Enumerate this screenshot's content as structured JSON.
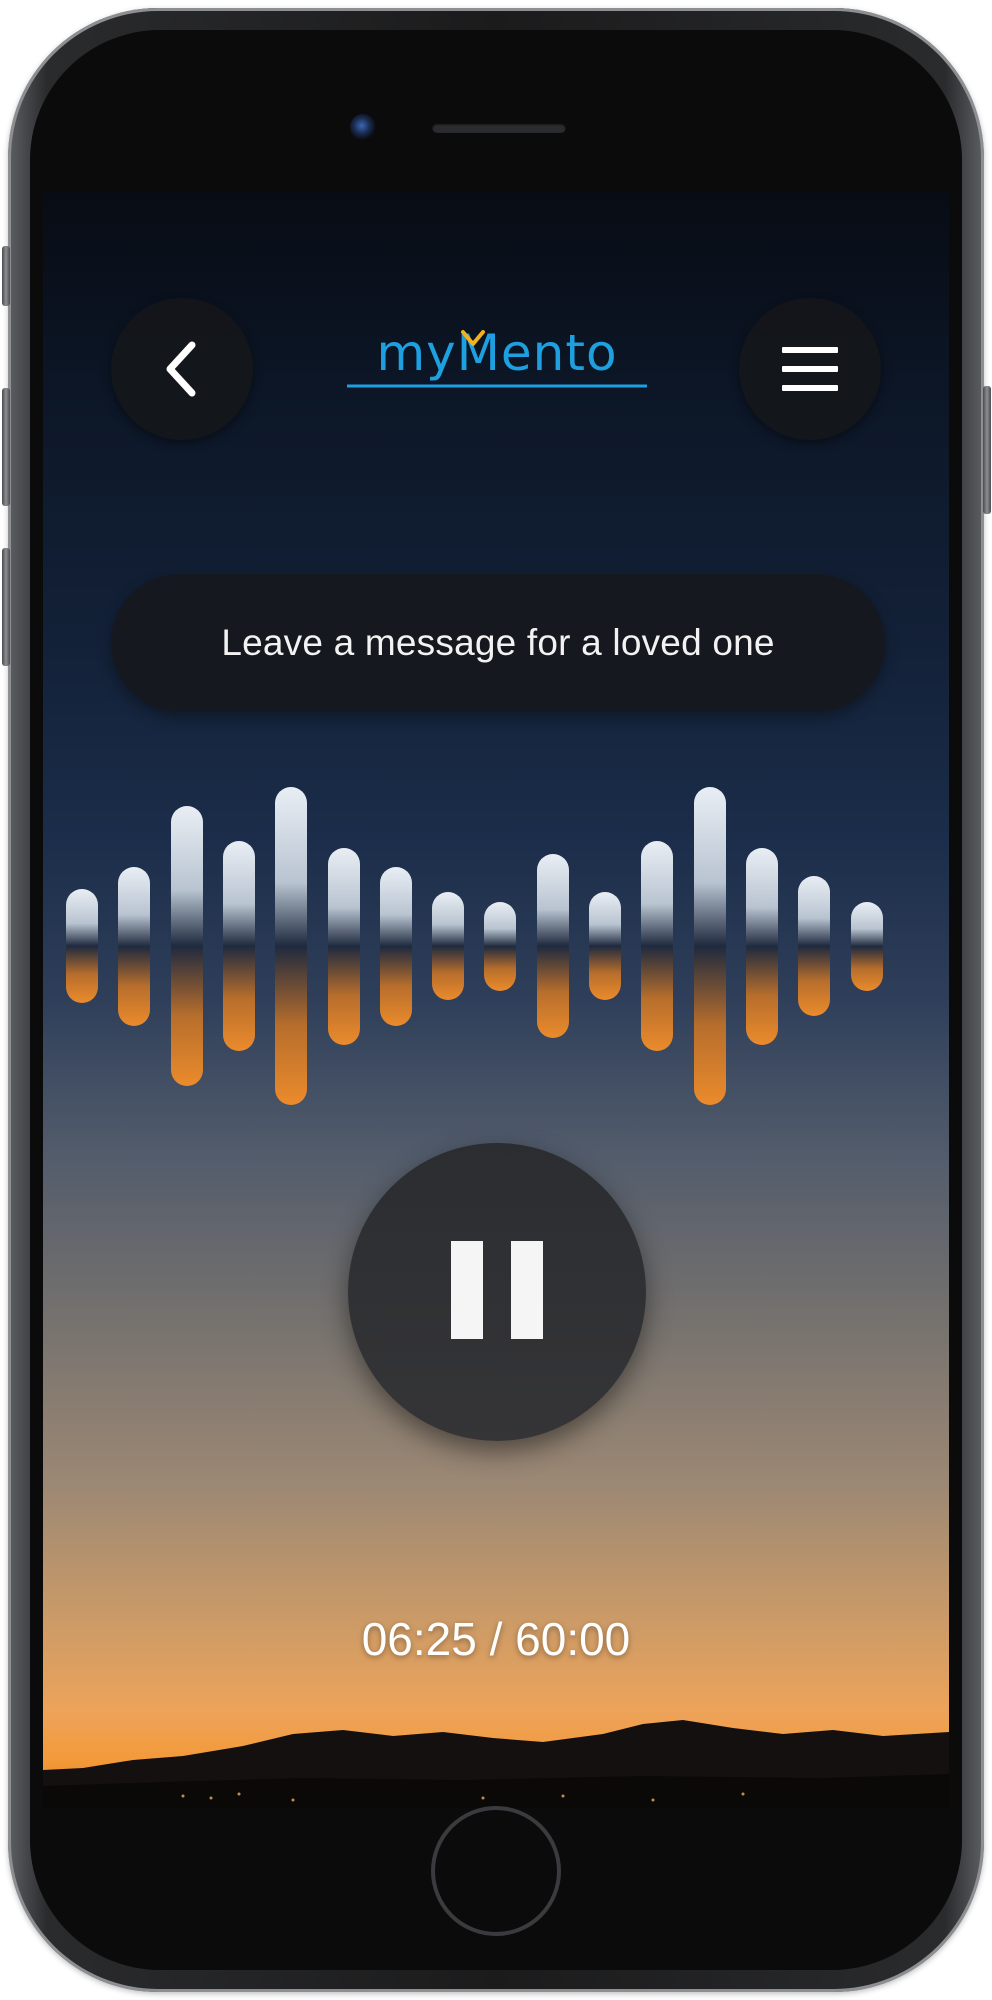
{
  "app": {
    "logo_text": "myMento",
    "colors": {
      "logo_blue": "#1e9fe0",
      "logo_accent": "#f3b21b",
      "sky_orange": "#f39a3a"
    }
  },
  "header": {
    "back_icon": "chevron-left-icon",
    "menu_icon": "hamburger-menu-icon"
  },
  "prompt": {
    "text": "Leave a message for a loved one"
  },
  "recorder": {
    "waveform_levels": [
      0.36,
      0.5,
      0.88,
      0.66,
      1.0,
      0.62,
      0.5,
      0.34,
      0.28,
      0.58,
      0.34,
      0.66,
      1.0,
      0.62,
      0.44,
      0.28
    ],
    "control_icon": "pause-icon",
    "elapsed": "06:25",
    "total": "60:00",
    "time_display": "06:25 / 60:00"
  }
}
